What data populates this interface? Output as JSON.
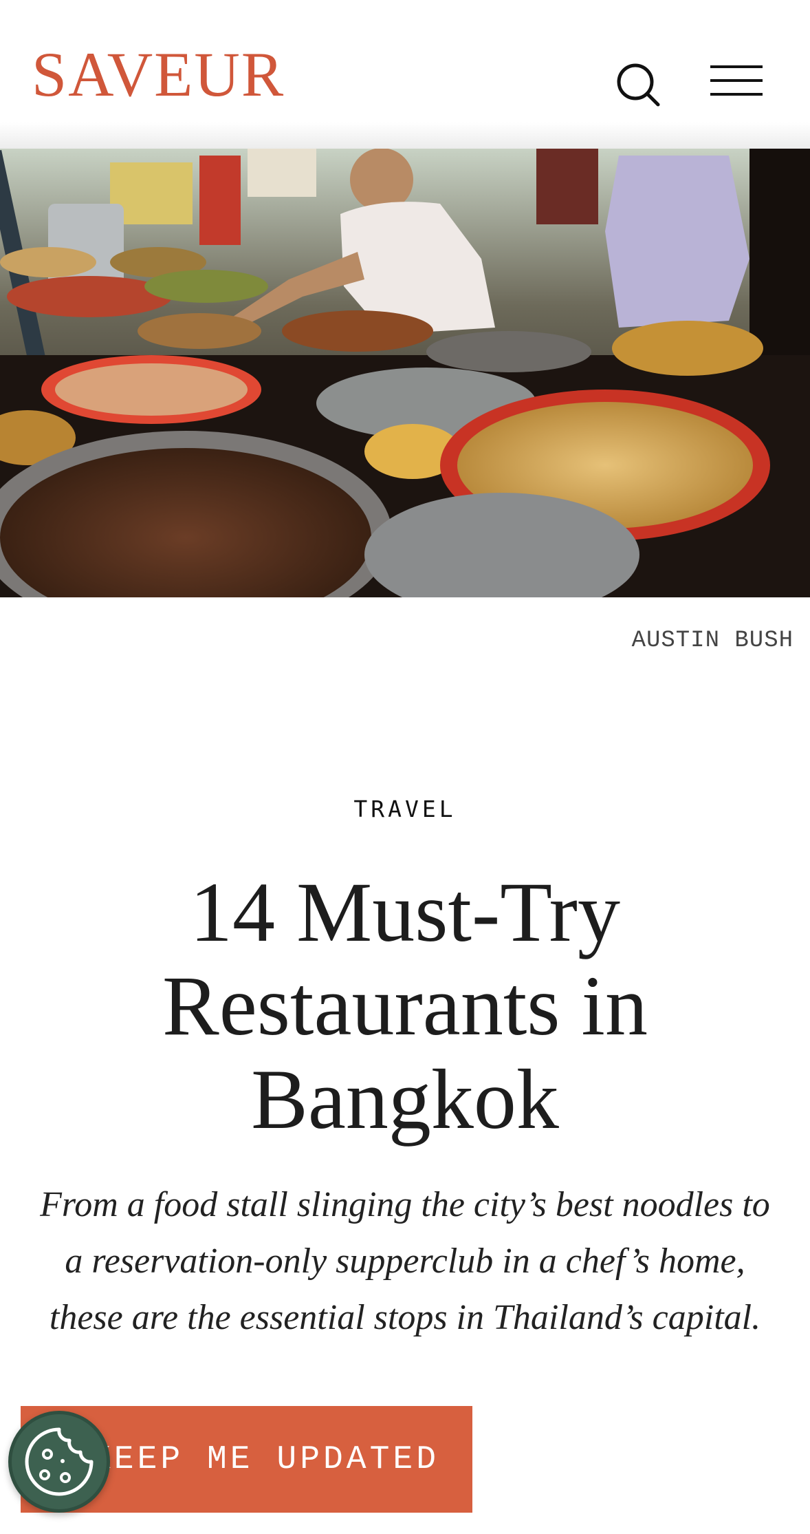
{
  "header": {
    "logo_text": "SAVEUR",
    "search_icon": "search-icon",
    "menu_icon": "hamburger-menu-icon"
  },
  "hero": {
    "image_subject": "street-food-stall-photo",
    "credit": "AUSTIN BUSH"
  },
  "article": {
    "category": "TRAVEL",
    "title": "14 Must-Try Restaurants in Bangkok",
    "dek": "From a food stall slinging the city’s best noodles to a reservation-only supperclub in a chef’s home, these are the essential stops in Thailand’s capital."
  },
  "cta": {
    "label": "KEEP ME UPDATED"
  },
  "cookie": {
    "icon": "cookie-icon"
  },
  "colors": {
    "brand": "#d0573a",
    "cta_background": "#d7603f",
    "cookie_button": "#3d6150"
  }
}
